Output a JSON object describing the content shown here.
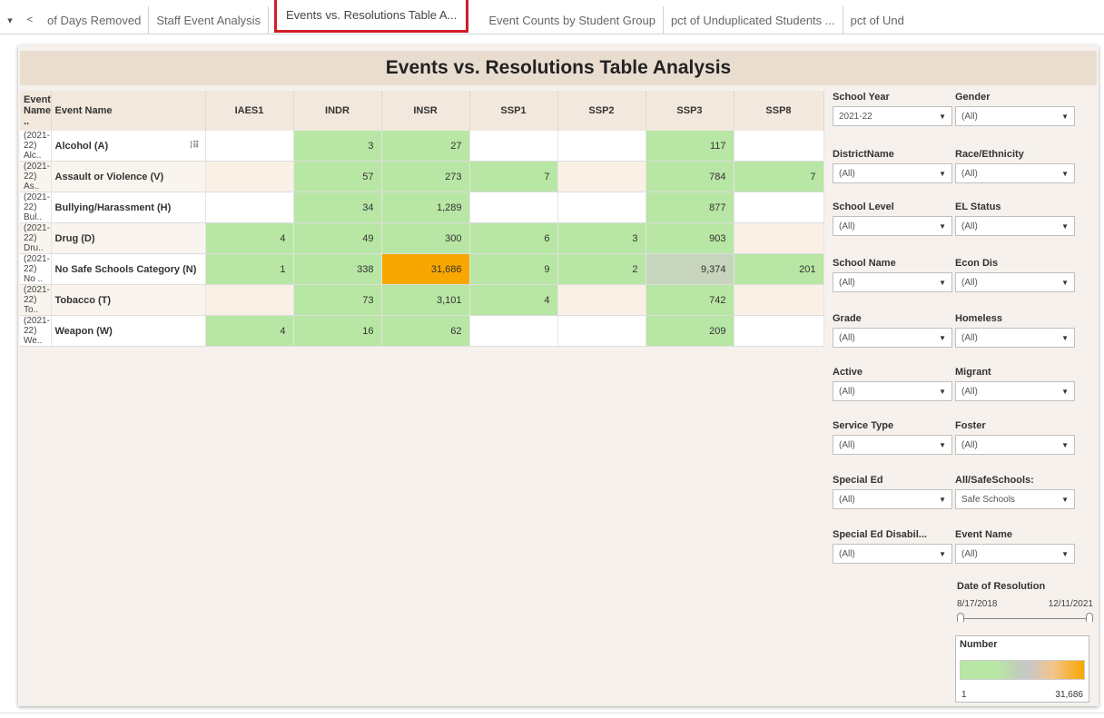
{
  "tabs": [
    {
      "label": "of Days Removed",
      "active": false
    },
    {
      "label": "Staff Event Analysis",
      "active": false
    },
    {
      "label": "Events vs. Resolutions Table A...",
      "active": true
    },
    {
      "label": "Event Counts by Student Group",
      "active": false
    },
    {
      "label": "pct of Unduplicated Students ...",
      "active": false
    },
    {
      "label": "pct of Und",
      "active": false
    }
  ],
  "tab_nav": {
    "menu_glyph": "▾",
    "prev_glyph": "<"
  },
  "title": "Events vs. Resolutions Table Analysis",
  "table": {
    "headers": [
      "Event Name ..",
      "Event Name",
      "IAES1",
      "INDR",
      "INSR",
      "SSP1",
      "SSP2",
      "SSP3",
      "SSP8"
    ],
    "rows": [
      {
        "code": "(2021-22) Alc..",
        "name": "Alcohol (A)",
        "cells": [
          "",
          "3",
          "27",
          "",
          "",
          "117",
          ""
        ]
      },
      {
        "code": "(2021-22) As..",
        "name": "Assault or Violence (V)",
        "cells": [
          "",
          "57",
          "273",
          "7",
          "",
          "784",
          "7"
        ]
      },
      {
        "code": "(2021-22) Bul..",
        "name": "Bullying/Harassment (H)",
        "cells": [
          "",
          "34",
          "1,289",
          "",
          "",
          "877",
          ""
        ]
      },
      {
        "code": "(2021-22) Dru..",
        "name": "Drug (D)",
        "cells": [
          "4",
          "49",
          "300",
          "6",
          "3",
          "903",
          ""
        ]
      },
      {
        "code": "(2021-22) No ..",
        "name": "No Safe Schools Category (N)",
        "cells": [
          "1",
          "338",
          "31,686",
          "9",
          "2",
          "9,374",
          "201"
        ]
      },
      {
        "code": "(2021-22) To..",
        "name": "Tobacco (T)",
        "cells": [
          "",
          "73",
          "3,101",
          "4",
          "",
          "742",
          ""
        ]
      },
      {
        "code": "(2021-22) We..",
        "name": "Weapon (W)",
        "cells": [
          "4",
          "16",
          "62",
          "",
          "",
          "209",
          ""
        ]
      }
    ],
    "selection_icon": "row-select-icon"
  },
  "filters": [
    {
      "label": "School Year",
      "value": "2021-22"
    },
    {
      "label": "Gender",
      "value": "(All)"
    },
    {
      "label": "DistrictName",
      "value": "(All)"
    },
    {
      "label": "Race/Ethnicity",
      "value": "(All)"
    },
    {
      "label": "School Level",
      "value": "(All)"
    },
    {
      "label": "EL Status",
      "value": "(All)"
    },
    {
      "label": "School Name",
      "value": "(All)"
    },
    {
      "label": "Econ Dis",
      "value": "(All)"
    },
    {
      "label": "Grade",
      "value": "(All)"
    },
    {
      "label": "Homeless",
      "value": "(All)"
    },
    {
      "label": "Active",
      "value": "(All)"
    },
    {
      "label": "Migrant",
      "value": "(All)"
    },
    {
      "label": "Service Type",
      "value": "(All)"
    },
    {
      "label": "Foster",
      "value": "(All)"
    },
    {
      "label": "Special Ed",
      "value": "(All)"
    },
    {
      "label": "All/SafeSchools:",
      "value": "Safe Schools"
    },
    {
      "label": "Special Ed Disabil...",
      "value": "(All)"
    },
    {
      "label": "Event Name",
      "value": "(All)"
    }
  ],
  "date_filter": {
    "label": "Date of Resolution",
    "start": "8/17/2018",
    "end": "12/11/2021"
  },
  "legend": {
    "title": "Number",
    "min": "1",
    "max": "31,686"
  },
  "colors": {
    "green": "#b8e6a4",
    "orange": "#f7a700",
    "gray_green": "#c7d5bd",
    "selected_tab_border": "#d11f26",
    "header_bg": "#e9ddd0"
  }
}
